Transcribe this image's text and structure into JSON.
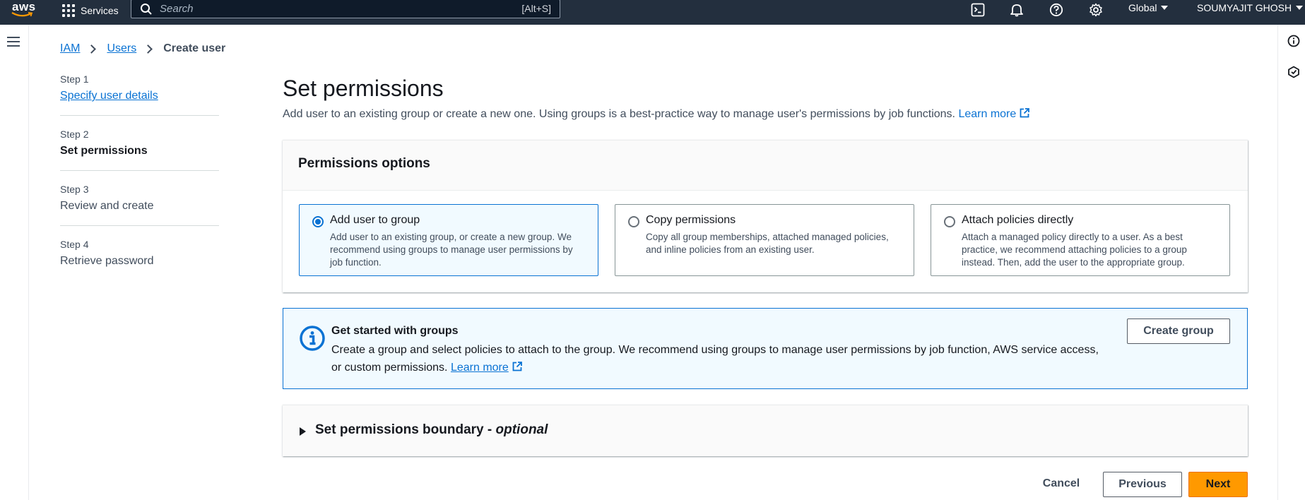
{
  "topnav": {
    "logo_text": "aws",
    "services_label": "Services",
    "search_placeholder": "Search",
    "search_shortcut": "[Alt+S]",
    "region_label": "Global",
    "account_label": "SOUMYAJIT GHOSH",
    "icons": [
      "cloudshell-icon",
      "bell-icon",
      "help-icon",
      "settings-icon"
    ]
  },
  "breadcrumb": {
    "items": [
      "IAM",
      "Users"
    ],
    "current": "Create user"
  },
  "steps": [
    {
      "num": "Step 1",
      "label": "Specify user details",
      "state": "link"
    },
    {
      "num": "Step 2",
      "label": "Set permissions",
      "state": "active"
    },
    {
      "num": "Step 3",
      "label": "Review and create",
      "state": "pending"
    },
    {
      "num": "Step 4",
      "label": "Retrieve password",
      "state": "pending"
    }
  ],
  "page": {
    "title": "Set permissions",
    "description": "Add user to an existing group or create a new one. Using groups is a best-practice way to manage user's permissions by job functions.",
    "learn_more": "Learn more"
  },
  "permissions": {
    "header": "Permissions options",
    "options": [
      {
        "title": "Add user to group",
        "desc": "Add user to an existing group, or create a new group. We recommend using groups to manage user permissions by job function.",
        "selected": true
      },
      {
        "title": "Copy permissions",
        "desc": "Copy all group memberships, attached managed policies, and inline policies from an existing user.",
        "selected": false
      },
      {
        "title": "Attach policies directly",
        "desc": "Attach a managed policy directly to a user. As a best practice, we recommend attaching policies to a group instead. Then, add the user to the appropriate group.",
        "selected": false
      }
    ]
  },
  "info": {
    "title": "Get started with groups",
    "text": "Create a group and select policies to attach to the group. We recommend using groups to manage user permissions by job function, AWS service access, or custom permissions.",
    "learn_more": "Learn more",
    "button": "Create group"
  },
  "boundary": {
    "title": "Set permissions boundary -",
    "optional": "optional"
  },
  "footer": {
    "cancel": "Cancel",
    "previous": "Previous",
    "next": "Next"
  },
  "colors": {
    "nav_bg": "#232f3e",
    "link": "#0972d3",
    "primary_button": "#ff9900",
    "info_bg": "#f1faff"
  }
}
